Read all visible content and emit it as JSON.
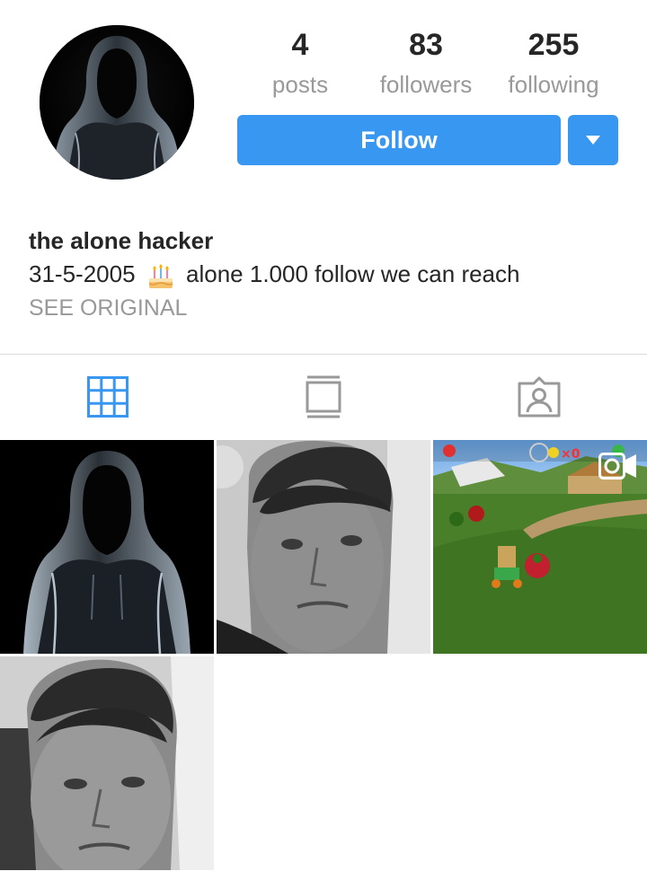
{
  "profile": {
    "avatar_alt": "hooded figure",
    "stats": [
      {
        "value": "4",
        "label": "posts"
      },
      {
        "value": "83",
        "label": "followers"
      },
      {
        "value": "255",
        "label": "following"
      }
    ],
    "follow_label": "Follow",
    "dropdown_icon": "chevron-down-icon"
  },
  "bio": {
    "name": "the alone hacker",
    "date": "31-5-2005",
    "emoji": "birthday-cake-icon",
    "text": "alone 1.000 follow we can reach",
    "see_original": "SEE ORIGINAL"
  },
  "tabs": [
    {
      "icon": "grid-icon",
      "active": true
    },
    {
      "icon": "feed-icon",
      "active": false
    },
    {
      "icon": "tagged-user-icon",
      "active": false
    }
  ],
  "posts": [
    {
      "type": "photo",
      "subject": "hooded figure"
    },
    {
      "type": "photo",
      "subject": "grayscale selfie"
    },
    {
      "type": "video",
      "subject": "3d platformer game"
    },
    {
      "type": "photo",
      "subject": "grayscale selfie"
    }
  ],
  "colors": {
    "accent": "#3897f0",
    "text_primary": "#262626",
    "text_secondary": "#999999",
    "divider": "#dbdbdb"
  }
}
